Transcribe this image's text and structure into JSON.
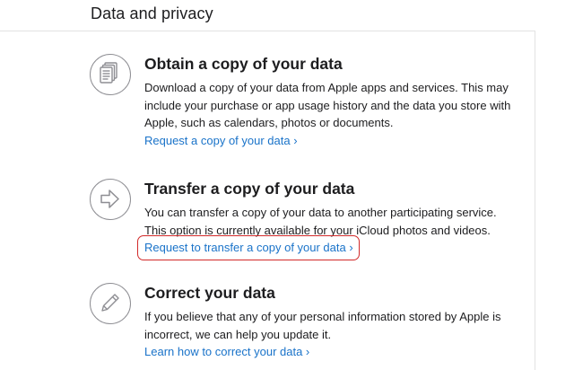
{
  "page": {
    "title": "Data and privacy"
  },
  "sections": [
    {
      "icon": "documents-icon",
      "heading": "Obtain a copy of your data",
      "description": "Download a copy of your data from Apple apps and services. This may include your purchase or app usage history and the data you store with Apple, such as calendars, photos or documents.",
      "link": "Request a copy of your data ›"
    },
    {
      "icon": "arrow-right-icon",
      "heading": "Transfer a copy of your data",
      "description": "You can transfer a copy of your data to another participating service. This option is currently available for your iCloud photos and videos.",
      "link": "Request to transfer a copy of your data ›",
      "highlight_color": "#d22a2a"
    },
    {
      "icon": "pencil-icon",
      "heading": "Correct your data",
      "description": "If you believe that any of your personal information stored by Apple is incorrect, we can help you update it.",
      "link": "Learn how to correct your data ›"
    }
  ],
  "colors": {
    "link": "#1a73c9",
    "text": "#1d1d1f",
    "icon_stroke": "#8e8e93",
    "divider": "#e3e3e3"
  }
}
